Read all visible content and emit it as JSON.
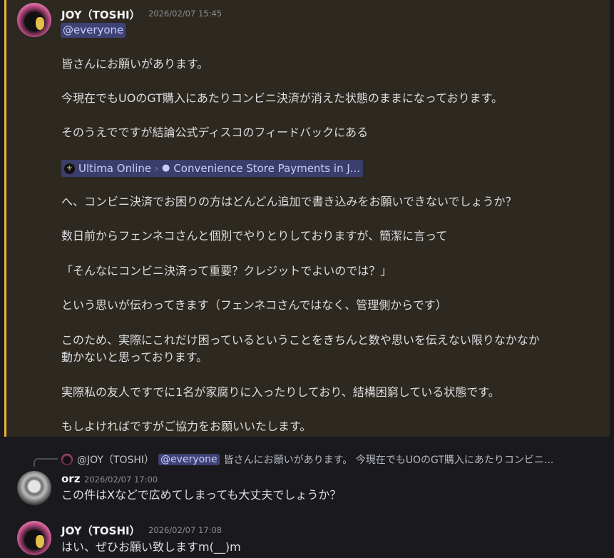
{
  "messages": [
    {
      "author": "JOY（TOSHI）",
      "timestamp": "2026/02/07 15:45",
      "mention": "@everyone",
      "lines": [
        "皆さんにお願いがあります。",
        "今現在でもUOのGT購入にあたりコンビニ決済が消えた状態のままになっております。",
        "そのうえでですが結論公式ディスコのフィードバックにある",
        "へ、コンビニ決済でお困りの方はどんどん追加で書き込みをお願いできないでしょうか？",
        "数日前からフェンネコさんと個別でやりとりしておりますが、簡潔に言って",
        "「そんなにコンビニ決済って重要？クレジットでよいのでは？」",
        "という思いが伝わってきます（フェンネコさんではなく、管理側からです）",
        "このため、実際にこれだけ困っているということをきちんと数や思いを伝えない限りなかなか",
        "動かないと思っております。",
        "実際私の友人ですでに1名が家腐りに入ったりしており、結構困窮している状態です。",
        "もしよければですがご協力をお願いいたします。"
      ],
      "channel_link": {
        "server": "Ultima Online",
        "channel": "Convenience Store Payments in J..."
      }
    },
    {
      "reply_to": {
        "author": "@JOY（TOSHI）",
        "mention": "@everyone",
        "preview": "皆さんにお願いがあります。 今現在でもUOのGT購入にあたりコンビニ..."
      },
      "author": "orz",
      "timestamp": "2026/02/07 17:00",
      "text": "この件はXなどで広めてしまっても大丈夫でしょうか？"
    },
    {
      "author": "JOY（TOSHI）",
      "timestamp": "2026/02/07 17:08",
      "text": "はい、ぜひお願い致しますm(__)m"
    }
  ],
  "colors": {
    "highlight_bg": "#2d2820",
    "highlight_bar": "#f0b232",
    "mention_bg": "#3e4274",
    "mention_text": "#c9cdfb",
    "background": "#1a1a1e"
  },
  "icons": [
    "server-icon",
    "chevron-right-icon",
    "chat-bubble-icon"
  ]
}
